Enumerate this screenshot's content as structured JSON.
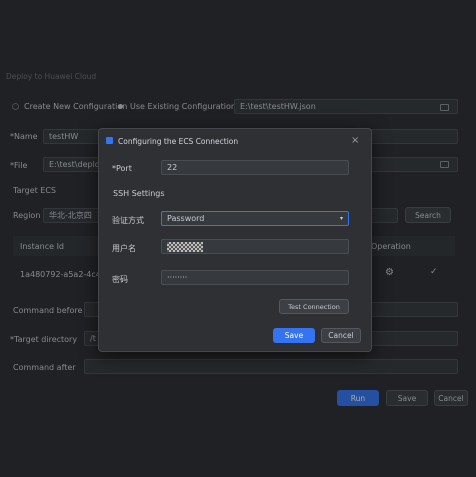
{
  "window": {
    "title": "Deploy to Huawei Cloud"
  },
  "config": {
    "create_label": "Create New Configuration",
    "use_existing_label": "Use Existing Configuration",
    "file_path": "E:\\test\\testHW.json"
  },
  "form": {
    "name_label": "Name",
    "name_value": "testHW",
    "file_label": "File",
    "file_value": "E:\\test\\deplo",
    "target_ecs_label": "Target ECS",
    "region_label": "Region",
    "region_value": "华北-北京四",
    "search_label": "Search",
    "command_before_label": "Command before",
    "target_directory_label": "Target directory",
    "target_directory_value": "/t",
    "command_after_label": "Command after"
  },
  "table": {
    "instance_id_header": "Instance Id",
    "operation_header": "Operation",
    "row_instance_id": "1a480792-a5a2-4c4"
  },
  "footer": {
    "run_label": "Run",
    "save_label": "Save",
    "cancel_label": "Cancel"
  },
  "dialog": {
    "title": "Configuring the ECS Connection",
    "port_label": "Port",
    "port_value": "22",
    "ssh_settings_label": "SSH Settings",
    "auth_label": "验证方式",
    "auth_value": "Password",
    "username_label": "用户名",
    "password_label": "密码",
    "password_value": "········",
    "test_connection_label": "Test Connection",
    "save_label": "Save",
    "cancel_label": "Cancel"
  },
  "colors": {
    "accent": "#3574f0",
    "background": "#2b2d30",
    "field": "#36393d"
  }
}
